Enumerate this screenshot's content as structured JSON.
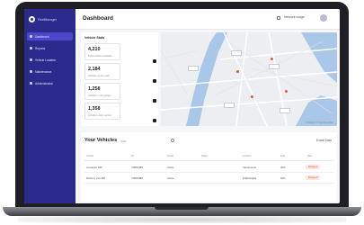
{
  "colors": {
    "sidebar": "#2c2a8c",
    "sidebar_active": "#4a48c8",
    "accent": "#e2573b",
    "screen_bg": "#f5f6f8",
    "water": "#a9c7e8"
  },
  "brand": {
    "name": "FleetManager",
    "logo_icon": "logo-icon"
  },
  "sidebar": {
    "items": [
      {
        "label": "Dashboard",
        "icon": "dashboard-icon",
        "active": true
      },
      {
        "label": "Reports",
        "icon": "reports-icon"
      },
      {
        "label": "Vehicle Location",
        "icon": "location-icon"
      },
      {
        "label": "Maintenance",
        "icon": "wrench-icon"
      },
      {
        "label": "Administration",
        "icon": "admin-icon"
      }
    ]
  },
  "header": {
    "title": "Dashboard",
    "account_label": "Network usage",
    "export_icon": "export-icon"
  },
  "stats": {
    "title": "Vehicle Stats",
    "cards": [
      {
        "value": "4,210",
        "label": "Total vehicles available"
      },
      {
        "value": "2,184",
        "label": "Vehicles on the road"
      },
      {
        "value": "1,258",
        "label": "Vehicles in the garage"
      },
      {
        "value": "1,358",
        "label": "Vehicles under service"
      }
    ]
  },
  "map": {
    "attribution": "© Mapbox © OpenStreetMap"
  },
  "vehicles": {
    "title": "Your Vehicles",
    "count": "(128)",
    "filter_label": "Export Data",
    "columns": [
      "Vehicle",
      "ID",
      "Driver",
      "Status",
      "Location",
      "Fuel",
      "Alert"
    ],
    "rows": [
      {
        "vehicle": "Container 24ft",
        "id": "V3815485",
        "driver": "Active",
        "status": "",
        "location": "Sacramento",
        "fuel": "40%",
        "alert": "Delayed"
      },
      {
        "vehicle": "Delivery van 18ft",
        "id": "V3815488",
        "driver": "Active",
        "status": "",
        "location": "Philadelphia",
        "fuel": "52%",
        "alert": "Delayed"
      }
    ]
  }
}
